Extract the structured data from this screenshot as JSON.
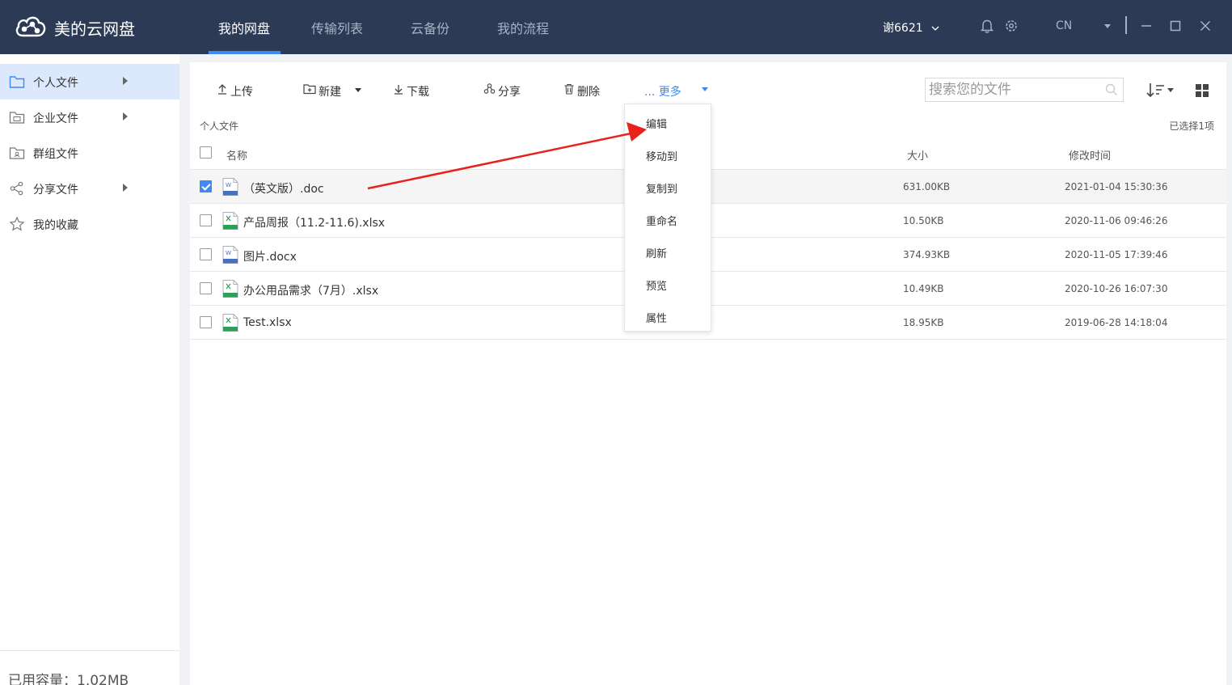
{
  "app": {
    "title": "美的云网盘"
  },
  "nav": {
    "tabs": [
      "我的网盘",
      "传输列表",
      "云备份",
      "我的流程"
    ]
  },
  "user": {
    "name": "谢6621",
    "lang": "CN"
  },
  "sidebar": {
    "items": [
      {
        "label": "个人文件"
      },
      {
        "label": "企业文件"
      },
      {
        "label": "群组文件"
      },
      {
        "label": "分享文件"
      },
      {
        "label": "我的收藏"
      }
    ],
    "capacity": "已用容量：1.02MB"
  },
  "toolbar": {
    "upload": "上传",
    "new": "新建",
    "download": "下载",
    "share": "分享",
    "delete": "删除",
    "more": "... 更多"
  },
  "search": {
    "placeholder": "搜索您的文件"
  },
  "breadcrumb": "个人文件",
  "selected_count": "已选择1项",
  "table": {
    "headers": {
      "name": "名称",
      "size": "大小",
      "modified": "修改时间"
    },
    "rows": [
      {
        "name": "（英文版）.doc",
        "size": "631.00KB",
        "modified": "2021-01-04 15:30:36",
        "type": "word",
        "checked": true
      },
      {
        "name": "产品周报（11.2-11.6).xlsx",
        "size": "10.50KB",
        "modified": "2020-11-06 09:46:26",
        "type": "excel",
        "checked": false
      },
      {
        "name": "图片.docx",
        "size": "374.93KB",
        "modified": "2020-11-05 17:39:46",
        "type": "word",
        "checked": false
      },
      {
        "name": "办公用品需求（7月）.xlsx",
        "size": "10.49KB",
        "modified": "2020-10-26 16:07:30",
        "type": "excel",
        "checked": false
      },
      {
        "name": "Test.xlsx",
        "size": "18.95KB",
        "modified": "2019-06-28 14:18:04",
        "type": "excel",
        "checked": false
      }
    ]
  },
  "more_menu": {
    "items": [
      "编辑",
      "移动到",
      "复制到",
      "重命名",
      "刷新",
      "预览",
      "属性"
    ]
  },
  "colors": {
    "topbar": "#2c3a56",
    "accent": "#3d8af7",
    "annotation_arrow": "#e8211a"
  }
}
